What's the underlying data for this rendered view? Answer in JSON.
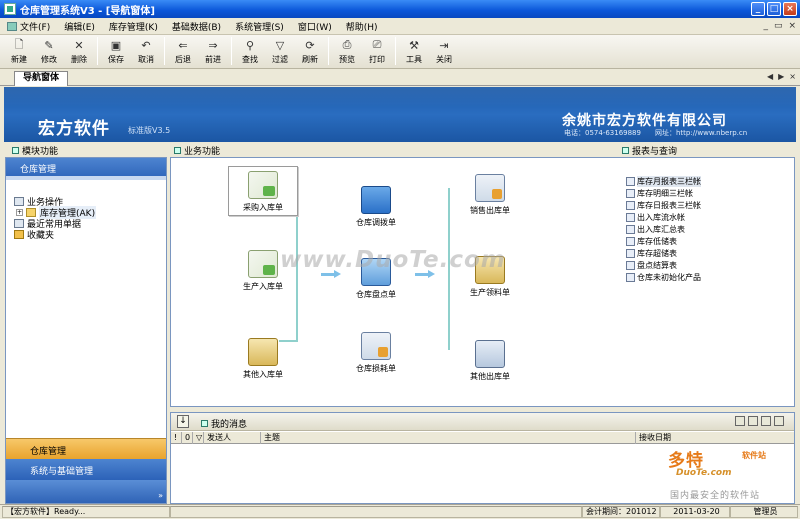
{
  "window": {
    "title": "仓库管理系统V3 - [导航窗体]",
    "btn_min": "_",
    "btn_max": "□",
    "btn_close": "×"
  },
  "menu": {
    "items": [
      {
        "label": "文件(F)"
      },
      {
        "label": "编辑(E)"
      },
      {
        "label": "库存管理(K)"
      },
      {
        "label": "基础数据(B)"
      },
      {
        "label": "系统管理(S)"
      },
      {
        "label": "窗口(W)"
      },
      {
        "label": "帮助(H)"
      }
    ],
    "win_min": "_",
    "win_restore": "▭",
    "win_close": "×"
  },
  "toolbar": {
    "new": "新建",
    "edit": "修改",
    "delete": "删除",
    "save": "保存",
    "cancel": "取消",
    "back": "后退",
    "forward": "前进",
    "find": "查找",
    "filter": "过滤",
    "refresh": "刷新",
    "preview": "预览",
    "print": "打印",
    "tools": "工具",
    "close": "关闭"
  },
  "doc_tab": {
    "label": "导航窗体",
    "ctrl_prev": "◀",
    "ctrl_next": "▶",
    "ctrl_close": "×"
  },
  "banner": {
    "brand": "宏方软件",
    "edition": "标准版V3.5",
    "company": "余姚市宏方软件有限公司",
    "contact": "电话：0574-63169889　　网址：http://www.nberp.cn"
  },
  "sections": {
    "modules": "模块功能",
    "business": "业务功能",
    "reports": "报表与查询"
  },
  "left_panel": {
    "header": "仓库管理",
    "tree": {
      "root": "业务操作",
      "child": "库存管理(AK)",
      "child_expander": "+",
      "recent": "最近常用单据",
      "favorites": "收藏夹"
    },
    "nav_active": "仓库管理",
    "nav_other": "系统与基础管理",
    "nav_more": "»"
  },
  "business_flow": {
    "purchase_in": "采购入库单",
    "production_in": "生产入库单",
    "other_in": "其他入库单",
    "transfer": "仓库调拨单",
    "stocktake": "仓库盘点单",
    "loss": "仓库损耗单",
    "sales_out": "销售出库单",
    "production_pick": "生产领料单",
    "other_out": "其他出库单"
  },
  "reports": [
    "库存月报表三栏帐",
    "库存明细三栏帐",
    "库存日报表三栏帐",
    "出入库流水帐",
    "出入库汇总表",
    "库存低储表",
    "库存超储表",
    "盘点结算表",
    "仓库未初始化产品"
  ],
  "messages": {
    "title": "我的消息",
    "head_icon": "↓",
    "col_flag": "!",
    "col_attach": "0",
    "col_filter": "▽",
    "col_sender": "发送人",
    "col_subject": "主题",
    "col_date": "接收日期"
  },
  "watermark": {
    "main": "www.DuoTe.com",
    "logo_cn": "多特",
    "logo_small": "软件站",
    "logo_en": "DuoTe.com",
    "slogan": "国内最安全的软件站"
  },
  "status": {
    "app": "【宏方软件】Ready...",
    "period_label": "会计期间：201012",
    "date": "2011-03-20",
    "user": "管理员"
  },
  "colors": {
    "banner_blue": "#1c5aa8",
    "nav_orange": "#e8a32c",
    "panel_border": "#7a96c0",
    "flow_teal": "#8fd0cc"
  }
}
